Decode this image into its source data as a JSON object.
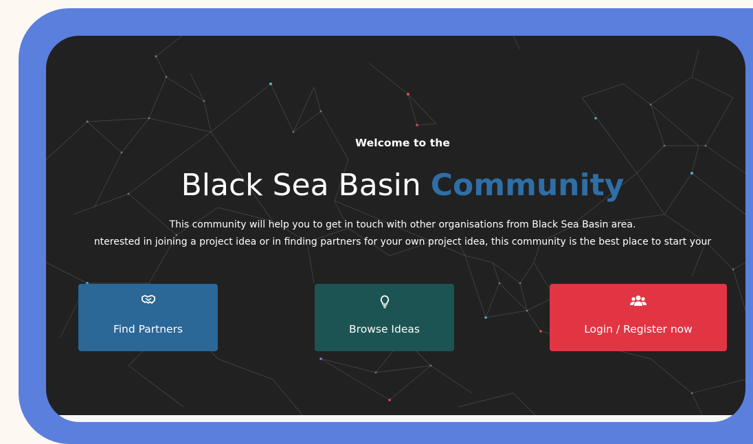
{
  "hero": {
    "welcome": "Welcome to the",
    "title_main": "Black Sea Basin",
    "title_accent": "Community",
    "description_line_1": "This community will help you to get in touch with other organisations from Black Sea Basin area.",
    "description_line_2": "nterested in joining a project idea or in finding partners for your own project idea, this community is the best place to start your"
  },
  "actions": [
    {
      "label": "Find Partners",
      "icon": "handshake-icon",
      "color": "#2b6797"
    },
    {
      "label": "Browse Ideas",
      "icon": "lightbulb-icon",
      "color": "#1c5453"
    },
    {
      "label": "Login / Register now",
      "icon": "users-icon",
      "color": "#e13544"
    }
  ],
  "colors": {
    "frame": "#5b7fdd",
    "screen_background": "#212121",
    "accent_text": "#2f6ea6",
    "page_background": "#fdf9f2"
  }
}
